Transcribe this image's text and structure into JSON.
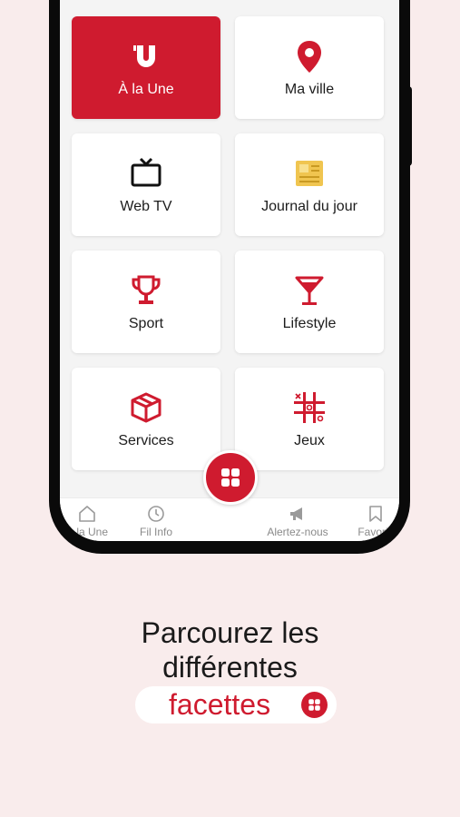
{
  "menu": {
    "tiles": [
      {
        "label": "À la Une",
        "icon": "u-logo-icon",
        "active": true
      },
      {
        "label": "Ma ville",
        "icon": "map-pin-icon"
      },
      {
        "label": "Web TV",
        "icon": "tv-icon"
      },
      {
        "label": "Journal du jour",
        "icon": "newspaper-icon"
      },
      {
        "label": "Sport",
        "icon": "trophy-icon"
      },
      {
        "label": "Lifestyle",
        "icon": "cocktail-icon"
      },
      {
        "label": "Services",
        "icon": "box-icon"
      },
      {
        "label": "Jeux",
        "icon": "tic-tac-toe-icon"
      }
    ]
  },
  "bottom_nav": {
    "items": [
      {
        "label": "À la Une",
        "icon": "home-icon"
      },
      {
        "label": "Fil Info",
        "icon": "clock-icon"
      },
      {
        "label": "",
        "icon": "grid-icon"
      },
      {
        "label": "Alertez-nous",
        "icon": "megaphone-icon"
      },
      {
        "label": "Favoris",
        "icon": "bookmark-icon"
      }
    ]
  },
  "tagline": {
    "line1": "Parcourez les",
    "line2": "différentes",
    "highlight": "facettes"
  },
  "colors": {
    "brand_red": "#cf1b2f",
    "background": "#f9ecec",
    "icon_yellow": "#f0c550"
  }
}
